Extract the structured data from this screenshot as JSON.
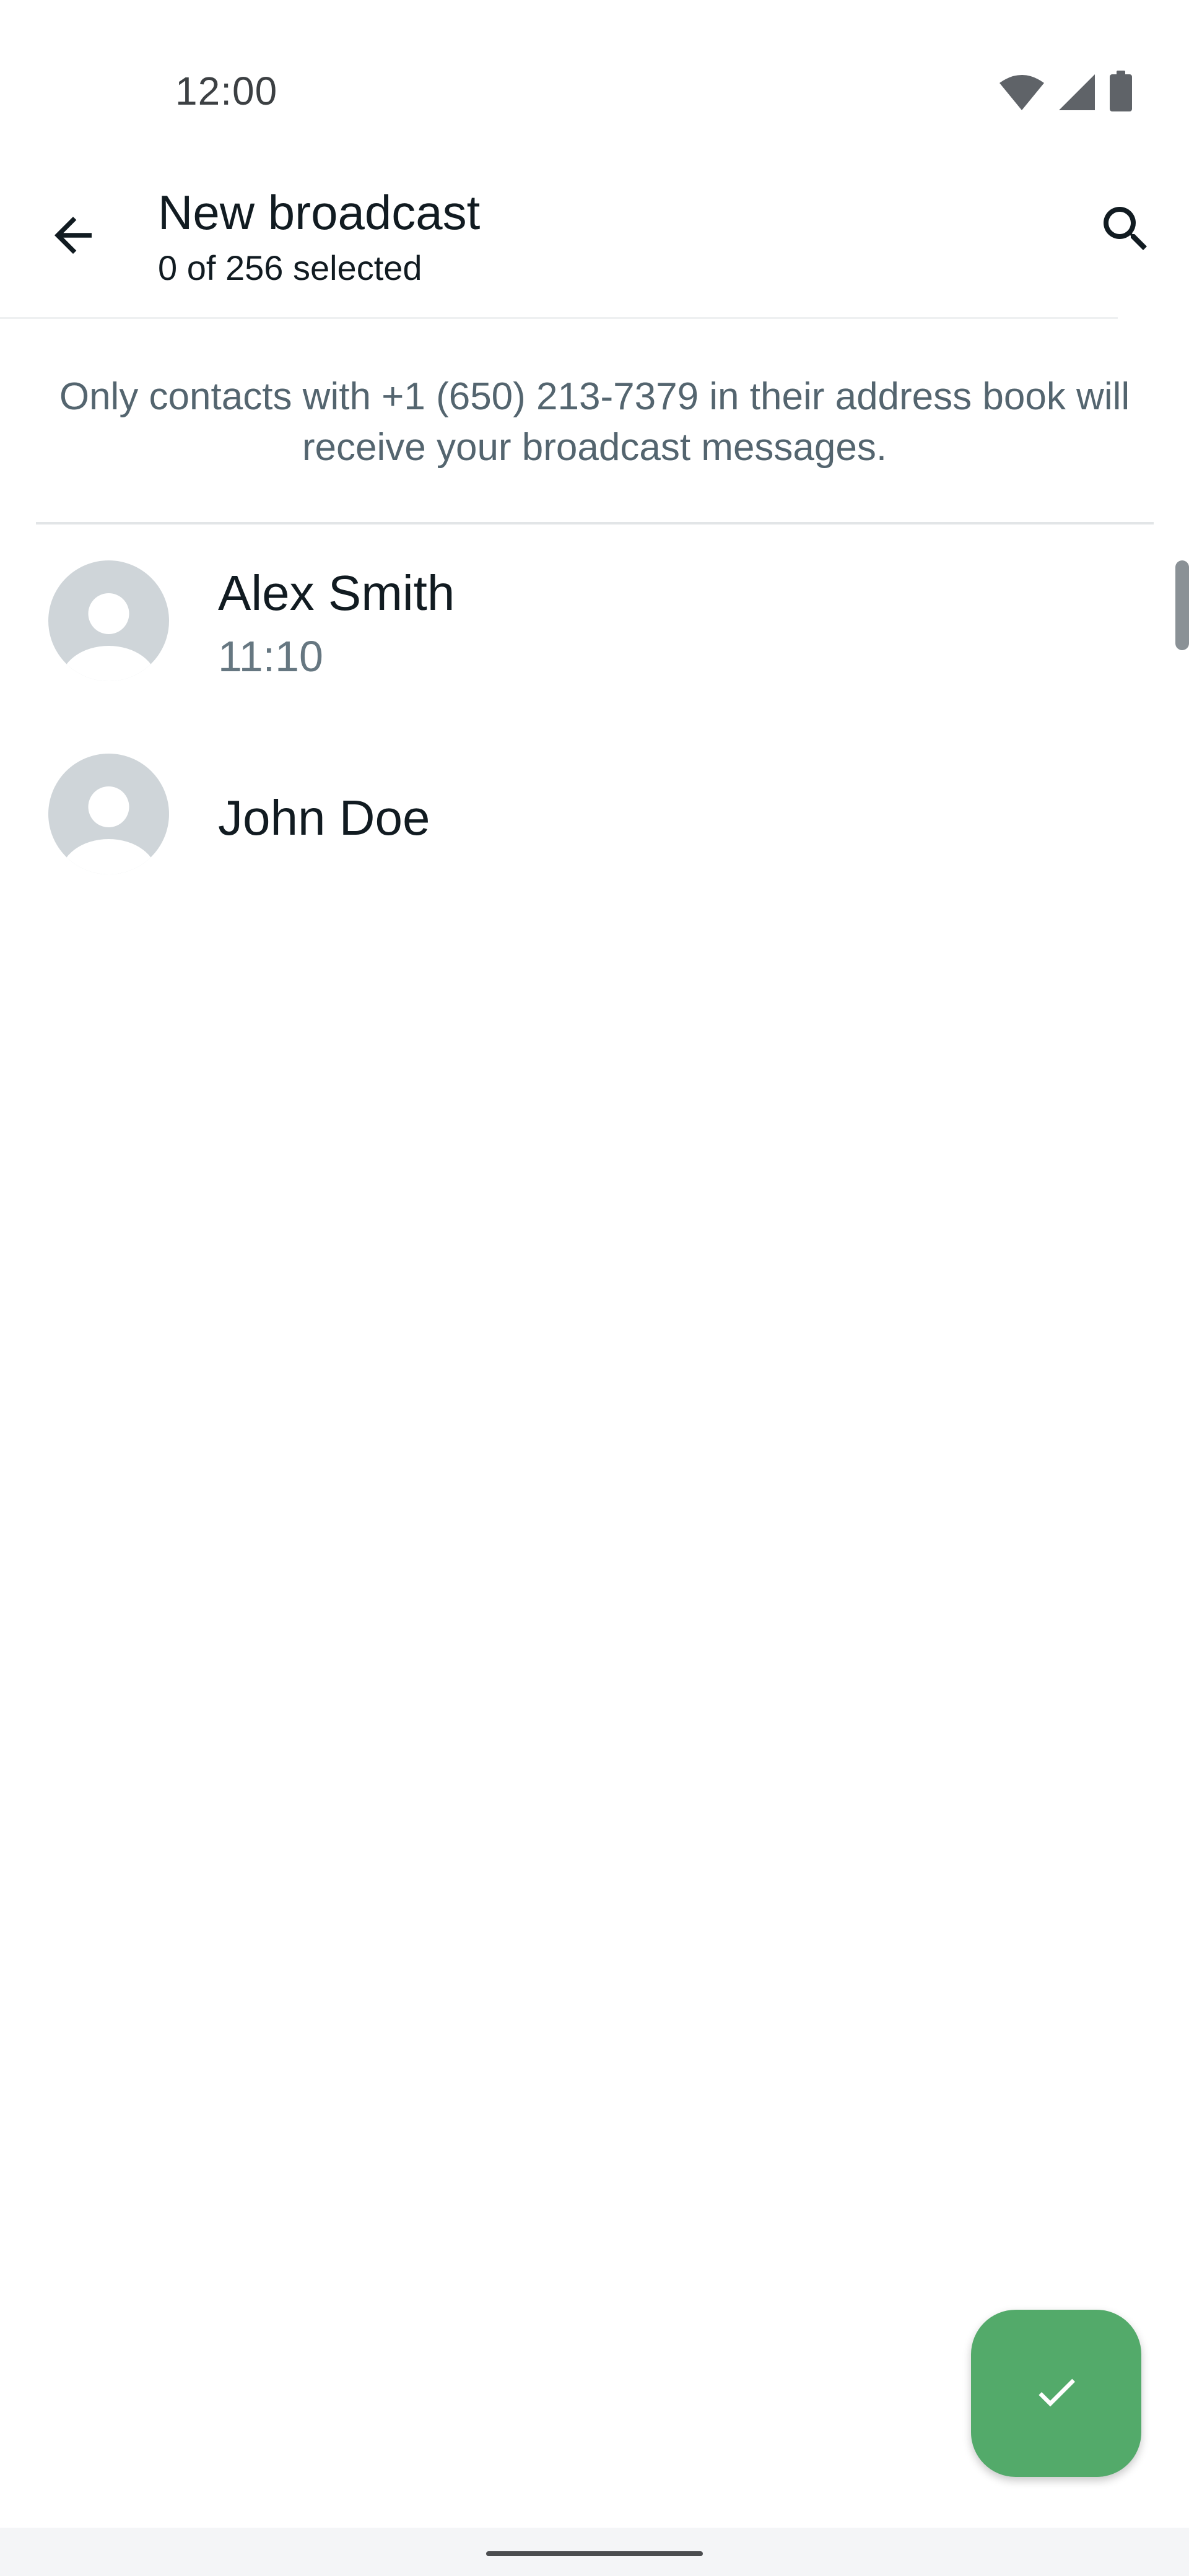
{
  "status_bar": {
    "time": "12:00",
    "icons": [
      "wifi-icon",
      "cellular-signal-icon",
      "battery-icon"
    ]
  },
  "toolbar": {
    "title": "New broadcast",
    "subtitle": "0 of 256 selected",
    "back_icon": "arrow-back-icon",
    "search_icon": "search-icon"
  },
  "notice": {
    "text": "Only contacts with +1 (650) 213-7379 in their address book will receive your broadcast messages."
  },
  "contacts": [
    {
      "name": "Alex Smith",
      "status": "11:10"
    },
    {
      "name": "John Doe",
      "status": ""
    }
  ],
  "fab": {
    "icon": "check-icon"
  },
  "colors": {
    "accent": "#53aa6a",
    "primary_text": "#111b21",
    "secondary_text": "#667781",
    "avatar_bg": "#cfd5d9"
  }
}
